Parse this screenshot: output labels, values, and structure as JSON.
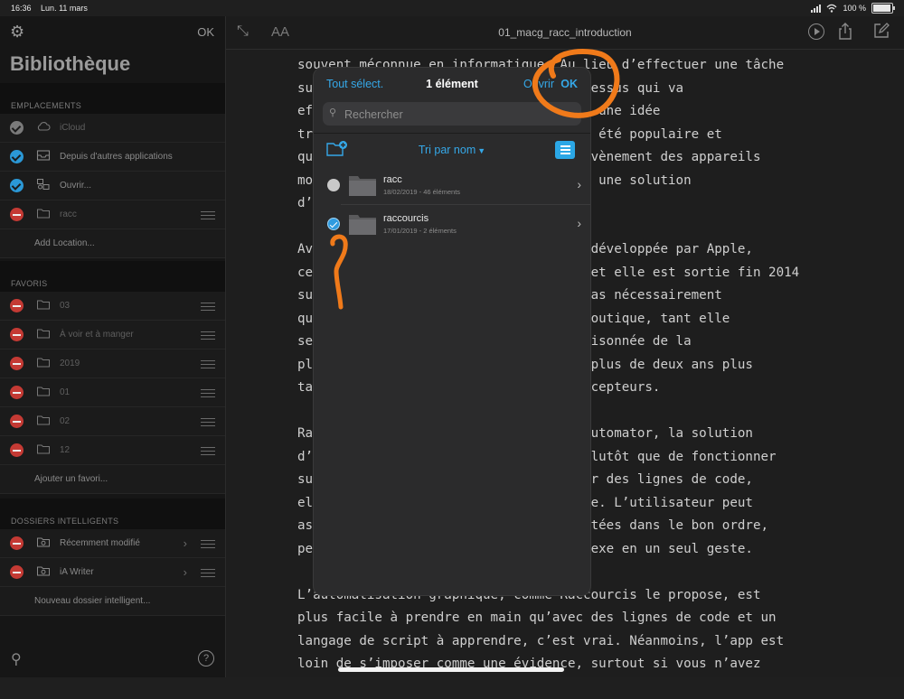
{
  "status": {
    "time": "16:36",
    "date": "Lun. 11 mars",
    "battery": "100 %"
  },
  "sidebar": {
    "done": "OK",
    "title": "Bibliothèque",
    "locations_header": "EMPLACEMENTS",
    "locations": [
      {
        "label": "iCloud",
        "state": "grey",
        "icon": "cloud-icon",
        "dim": true
      },
      {
        "label": "Depuis d'autres applications",
        "state": "blue",
        "icon": "inbox-icon"
      },
      {
        "label": "Ouvrir...",
        "state": "blue",
        "icon": "open-icon"
      },
      {
        "label": "racc",
        "state": "red",
        "icon": "folder-icon",
        "dim": true
      }
    ],
    "add_location": "Add Location...",
    "favorites_header": "FAVORIS",
    "favorites": [
      "03",
      "À voir et à manger",
      "2019",
      "01",
      "02",
      "12"
    ],
    "add_favorite": "Ajouter un favori...",
    "smart_header": "DOSSIERS INTELLIGENTS",
    "smart": [
      "Récemment modifié",
      "iA Writer"
    ],
    "add_smart": "Nouveau dossier intelligent..."
  },
  "editor": {
    "doc_title": "01_macg_racc_introduction",
    "text_size": "AA",
    "paragraphs": [
      [
        "souvent méconnue en informatique. Au lieu d’effectuer une tâche",
        "sur votre appareil, vous créez un processus qui va",
        "effectuer cette tâche pour vous. C’est une idée",
        "très ancienne, qui n’a jamais vraiment été populaire et",
        "qui s’est surtout démocratisé avec l’avènement des appareils",
        "mobiles. Raccourcis est, côté d’Apple, une solution",
        "d’automatisation dédiée à iOS."
      ],
      [
        "Avant d’être Raccourcis, avant d’être développée par Apple,",
        "cette application s’appelait Workflow et elle est sortie fin 2014",
        "sur l’App Store. Personne ne pensait pas nécessairement",
        "qu’elle aurait pu faire partie de la boutique, tant elle",
        "semblait contredire la philosophie cloisonnée de la",
        "plateforme. Apple l’a rachetée un peu plus de deux ans plus",
        "tard, et a conservé une partie des concepteurs."
      ],
      [
        "Raccourcis est un peu l’équivalent d’Automator, la solution",
        "d’automatisation graphique de macOS. Plutôt que de fonctionner",
        "sur un principe de scripts composés par des lignes de code,",
        "elle repose sur une interface graphique. L’utilisateur peut",
        "assembler des actions qui seront exécutées dans le bon ordre,",
        "permettant de réaliser une tâche complexe en un seul geste."
      ],
      [
        "L’automatisation graphique, comme Raccourcis le propose, est",
        "plus facile à prendre en main qu’avec des lignes de code et un",
        "langage de script à apprendre, c’est vrai. Néanmoins, l’app est",
        "loin de s’imposer comme une évidence, surtout si vous n’avez"
      ]
    ]
  },
  "popover": {
    "select_all": "Tout sélect.",
    "count": "1 élément",
    "open": "Ouvrir",
    "ok": "OK",
    "search_placeholder": "Rechercher",
    "sort": "Tri par nom",
    "files": [
      {
        "name": "racc",
        "meta": "18/02/2019 - 46 éléments",
        "selected": false
      },
      {
        "name": "raccourcis",
        "meta": "17/01/2019 - 2 éléments",
        "selected": true
      }
    ]
  },
  "colors": {
    "accent": "#35a8e8",
    "annotation": "#f07a1a",
    "delete": "#c43a34"
  }
}
